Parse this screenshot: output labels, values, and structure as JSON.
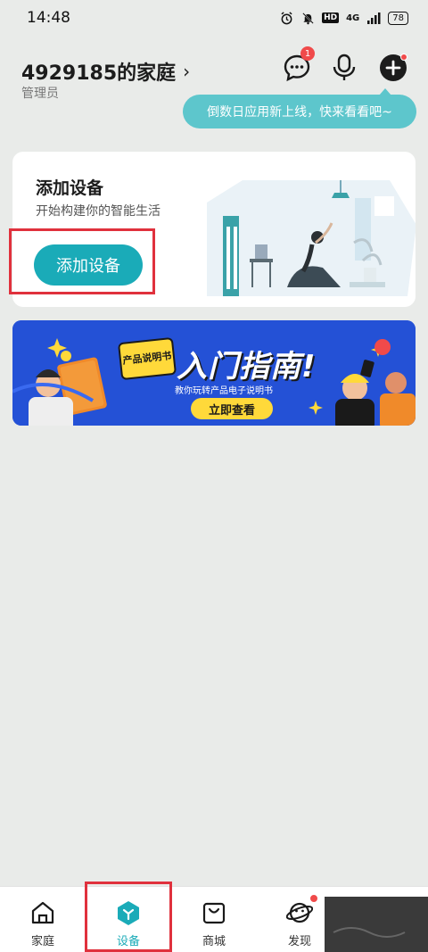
{
  "status_bar": {
    "time": "14:48",
    "network": "4G",
    "hd": "HD",
    "battery": "78"
  },
  "header": {
    "home_name": "4929185的家庭",
    "role": "管理员",
    "message_badge": "1",
    "tooltip": "倒数日应用新上线，快来看看吧~"
  },
  "add_device_card": {
    "title": "添加设备",
    "subtitle": "开始构建你的智能生活",
    "button_label": "添加设备"
  },
  "banner": {
    "tag": "产品说明书",
    "title": "入门指南!",
    "subtitle": "教你玩转产品电子说明书",
    "cta": "立即查看"
  },
  "bottom_nav": {
    "items": [
      {
        "label": "家庭",
        "icon": "home-icon",
        "active": false
      },
      {
        "label": "设备",
        "icon": "device-icon",
        "active": true
      },
      {
        "label": "商城",
        "icon": "shop-icon",
        "active": false
      },
      {
        "label": "发现",
        "icon": "discover-icon",
        "active": false
      }
    ]
  },
  "colors": {
    "accent": "#1aabb8",
    "tooltip": "#5dc6cc",
    "alert": "#f04a4a",
    "highlight": "#e0313d",
    "banner": "#2355d8"
  }
}
